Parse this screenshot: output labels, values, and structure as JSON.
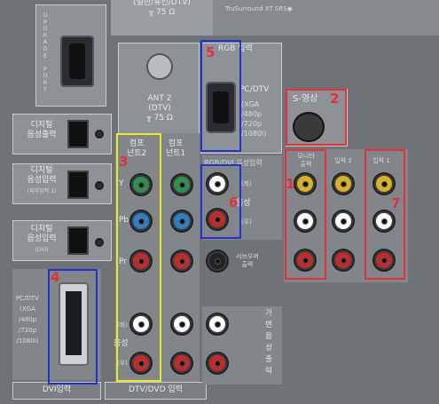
{
  "top_label": {
    "line1": "(일반/유선/DTV)",
    "line2": "╥ 75 Ω"
  },
  "top_right_label": "TruSurround XT SRS◉",
  "upgrade_port": {
    "label": "U\nP\nG\nR\nA\nD\nE\n \nP\nO\nR\nT"
  },
  "ant2": {
    "label": "ANT 2\n(DTV)\n╥ 75 Ω"
  },
  "rgb_input": {
    "title": "RGB 입력",
    "pc_dtv": "PC/DTV",
    "modes": "(XGA\n/480p\n/720p\n/1080i)"
  },
  "s_video": {
    "label": "S-영상"
  },
  "digital_audio_out": {
    "label": "디지털\n음성출력"
  },
  "digital_audio_in2": {
    "label": "디지털\n음성입력",
    "sub": "(외부입력 2)"
  },
  "digital_audio_in_dvi": {
    "label": "디지털\n음성입력",
    "sub": "(DVI)"
  },
  "component2": {
    "label": "컴포\n넌트2"
  },
  "component1": {
    "label": "컴포\n넌트1"
  },
  "component_rows": {
    "y": "Y",
    "pb": "Pb",
    "pr": "Pr"
  },
  "rgb_dvi_audio": {
    "title": "RGB/DVI 음성입력",
    "left": "(좌)",
    "audio": "음성",
    "right": "(우)"
  },
  "monitor_out": {
    "label": "모니터\n출력"
  },
  "input2": {
    "label": "입력 2"
  },
  "input1": {
    "label": "입력 1"
  },
  "pc_dvi": {
    "label": "PC/DTV\n(XGA\n/480p\n/720p\n/1080i)"
  },
  "dvi_input": {
    "label": "DVI입력"
  },
  "dtv_dvd_input": {
    "label": "DTV/DVD 입력"
  },
  "component_audio": {
    "left": "(좌)",
    "audio": "음성",
    "right": "(우)"
  },
  "woofer": {
    "label": "서브우퍼\n출력"
  },
  "fixed_audio_out": {
    "label": "가\n변\n음\n성\n출\n력"
  },
  "annotations": [
    {
      "id": "1",
      "color": "#e0323c"
    },
    {
      "id": "2",
      "color": "#e0323c"
    },
    {
      "id": "3",
      "color": "#e8ea2a"
    },
    {
      "id": "4",
      "color": "#2233cc"
    },
    {
      "id": "5",
      "color": "#2233cc"
    },
    {
      "id": "6",
      "color": "#e0323c"
    },
    {
      "id": "7",
      "color": "#e0323c"
    }
  ],
  "annotation_labels": {
    "n1": "1",
    "n2": "2",
    "n3": "3",
    "n4": "4",
    "n5": "5",
    "n6": "6",
    "n7": "7"
  }
}
